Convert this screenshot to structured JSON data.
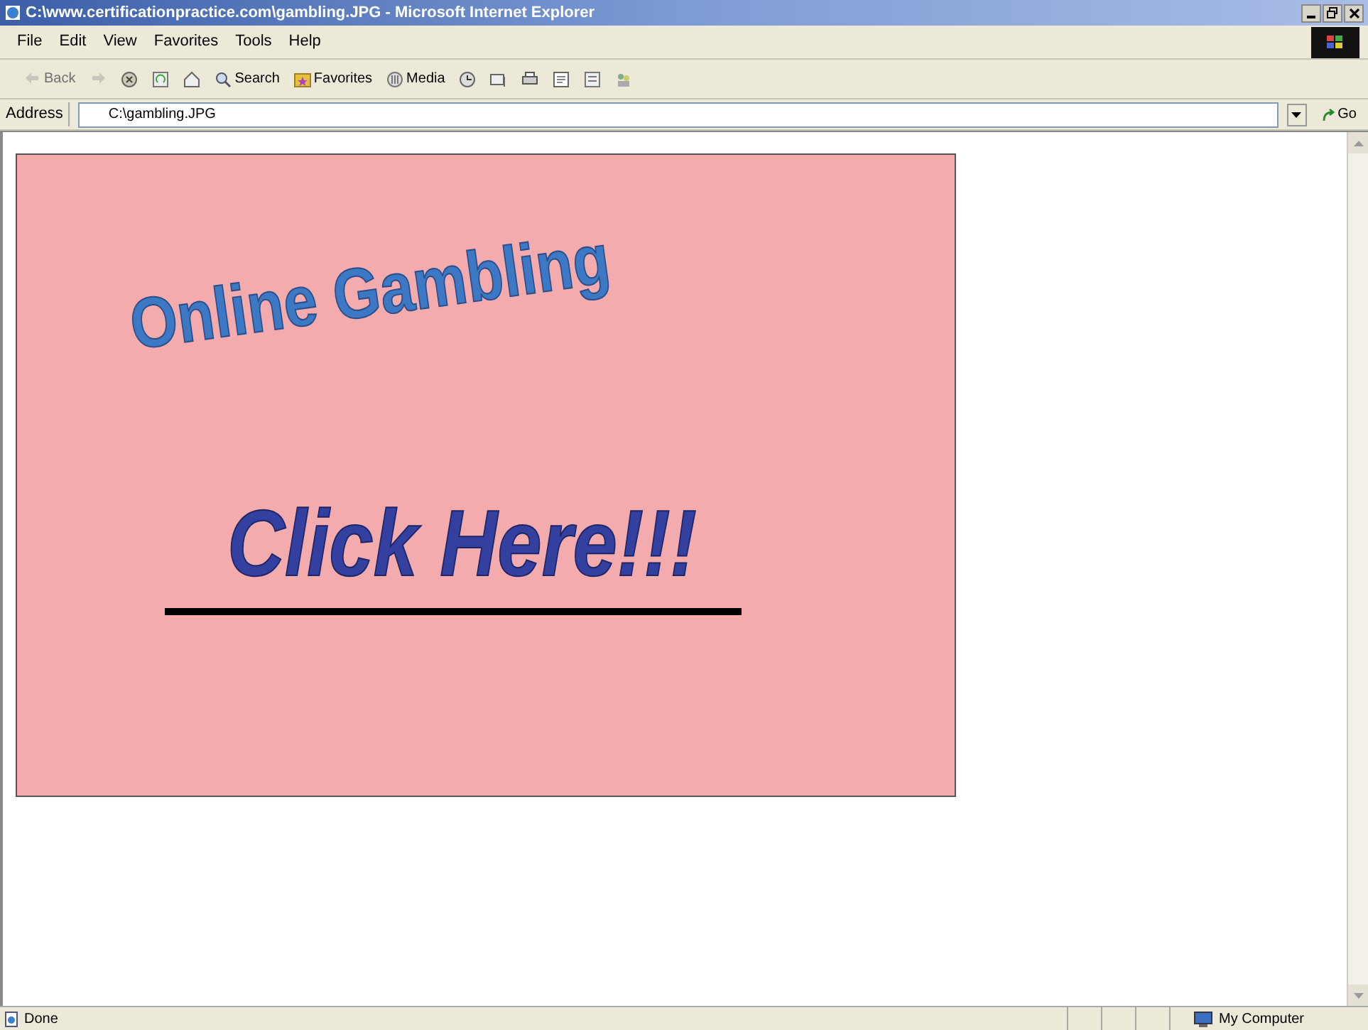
{
  "window": {
    "title": "C:\\www.certificationpractice.com\\gambling.JPG - Microsoft Internet Explorer"
  },
  "menu": [
    "File",
    "Edit",
    "View",
    "Favorites",
    "Tools",
    "Help"
  ],
  "toolbar": [
    {
      "kind": "back",
      "label": "Back",
      "disabled": true
    },
    {
      "kind": "forward",
      "disabled": true
    },
    {
      "kind": "stop"
    },
    {
      "kind": "refresh"
    },
    {
      "kind": "home"
    },
    {
      "kind": "search",
      "label": "Search"
    },
    {
      "kind": "favorites",
      "label": "Favorites"
    },
    {
      "kind": "media",
      "label": "Media"
    },
    {
      "kind": "history"
    },
    {
      "kind": "mail"
    },
    {
      "kind": "print"
    },
    {
      "kind": "edit"
    },
    {
      "kind": "discuss"
    },
    {
      "kind": "messenger"
    }
  ],
  "address_bar": {
    "label": "Address",
    "value": "C:\\gambling.JPG",
    "go": "Go"
  },
  "banner": {
    "headline": "Online Gambling",
    "call_to_action": "Click Here!!!"
  },
  "status_bar": {
    "text": "Done",
    "zone": "My Computer"
  }
}
